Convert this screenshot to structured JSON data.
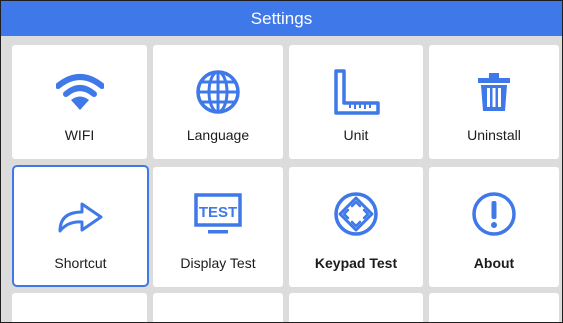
{
  "title": "Settings",
  "accent_color": "#3f78e8",
  "tiles": [
    {
      "label": "WIFI",
      "icon": "wifi-icon"
    },
    {
      "label": "Language",
      "icon": "globe-icon"
    },
    {
      "label": "Unit",
      "icon": "ruler-icon"
    },
    {
      "label": "Uninstall",
      "icon": "trash-icon"
    },
    {
      "label": "Shortcut",
      "icon": "share-arrow-icon",
      "selected": true
    },
    {
      "label": "Display Test",
      "icon": "display-test-icon",
      "icon_text": "TEST"
    },
    {
      "label": "Keypad Test",
      "icon": "keypad-arrows-icon"
    },
    {
      "label": "About",
      "icon": "info-exclamation-icon"
    }
  ]
}
